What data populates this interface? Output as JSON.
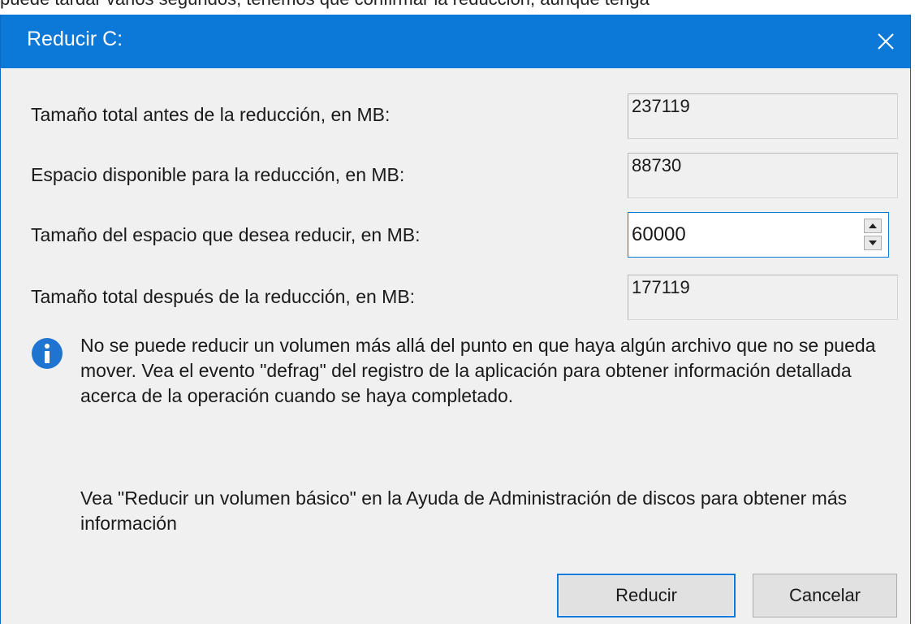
{
  "background_text": "puede tardar varios segundos, tenemos que confirmar la reducción, aunque tenga",
  "dialog": {
    "title": "Reducir C:",
    "close_label": "✕",
    "accent_color": "#0c78d8"
  },
  "fields": {
    "total_before": {
      "label": "Tamaño total antes de la reducción, en MB:",
      "value": "237119"
    },
    "available": {
      "label": "Espacio disponible para la reducción, en MB:",
      "value": "88730"
    },
    "shrink_amount": {
      "label": "Tamaño del espacio que desea reducir, en MB:",
      "value": "60000"
    },
    "total_after": {
      "label": "Tamaño total después de la reducción, en MB:",
      "value": "177119"
    }
  },
  "info_message": "No se puede reducir un volumen más allá del punto en que haya algún archivo que no se pueda mover. Vea el evento \"defrag\" del registro de la aplicación para obtener información detallada acerca de la operación cuando se haya completado.",
  "help_message": "Vea \"Reducir un volumen básico\"  en la Ayuda de Administración de discos para obtener más información",
  "buttons": {
    "primary": "Reducir",
    "secondary": "Cancelar"
  },
  "icons": {
    "info": "info-icon",
    "close": "close-icon",
    "spin_up": "chevron-up-icon",
    "spin_down": "chevron-down-icon"
  }
}
